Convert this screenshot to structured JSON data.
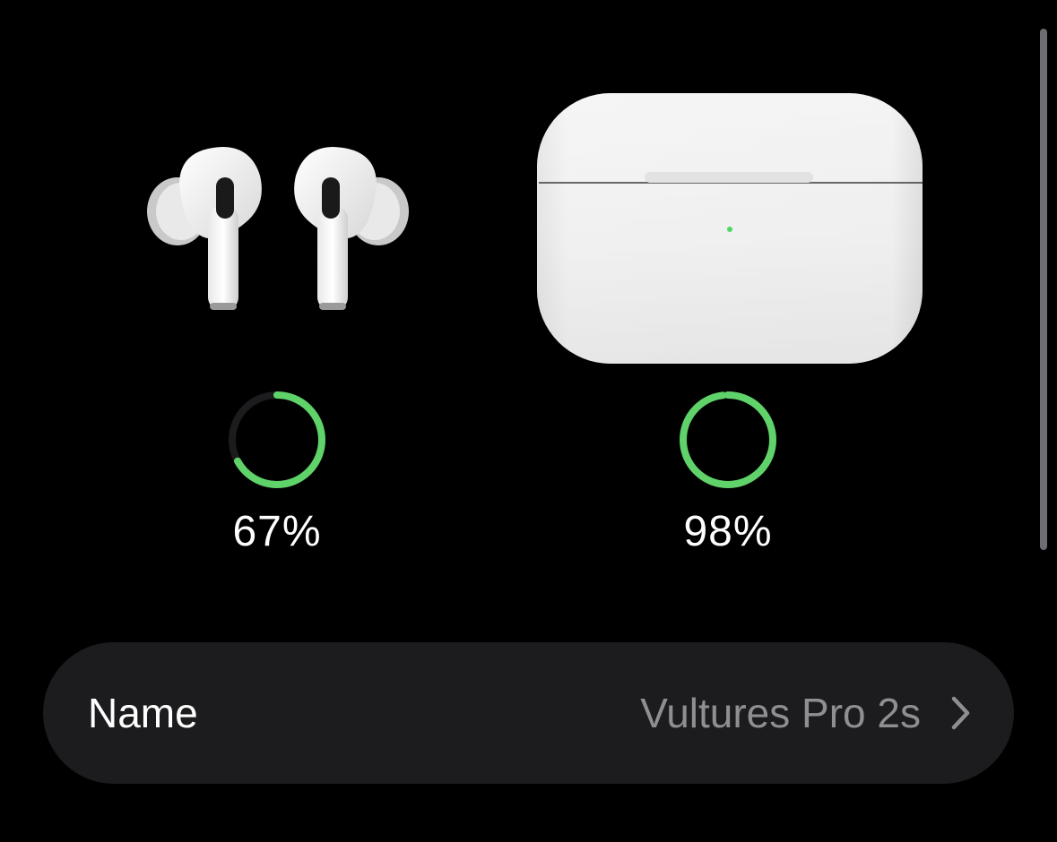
{
  "battery": {
    "buds": {
      "percent_label": "67%",
      "level": 0.67,
      "icon": "airpods-pro-earbuds-icon"
    },
    "case": {
      "percent_label": "98%",
      "level": 0.98,
      "icon": "airpods-pro-case-icon"
    }
  },
  "settings": {
    "name_row": {
      "label": "Name",
      "value": "Vultures Pro 2s",
      "icon": "chevron-right-icon"
    }
  },
  "colors": {
    "background": "#000000",
    "ring_fill": "#5fd36a",
    "ring_track": "#1c1c1e",
    "row_background": "#1c1c1e",
    "secondary_text": "#8e8e93",
    "status_led": "#4cd964"
  }
}
